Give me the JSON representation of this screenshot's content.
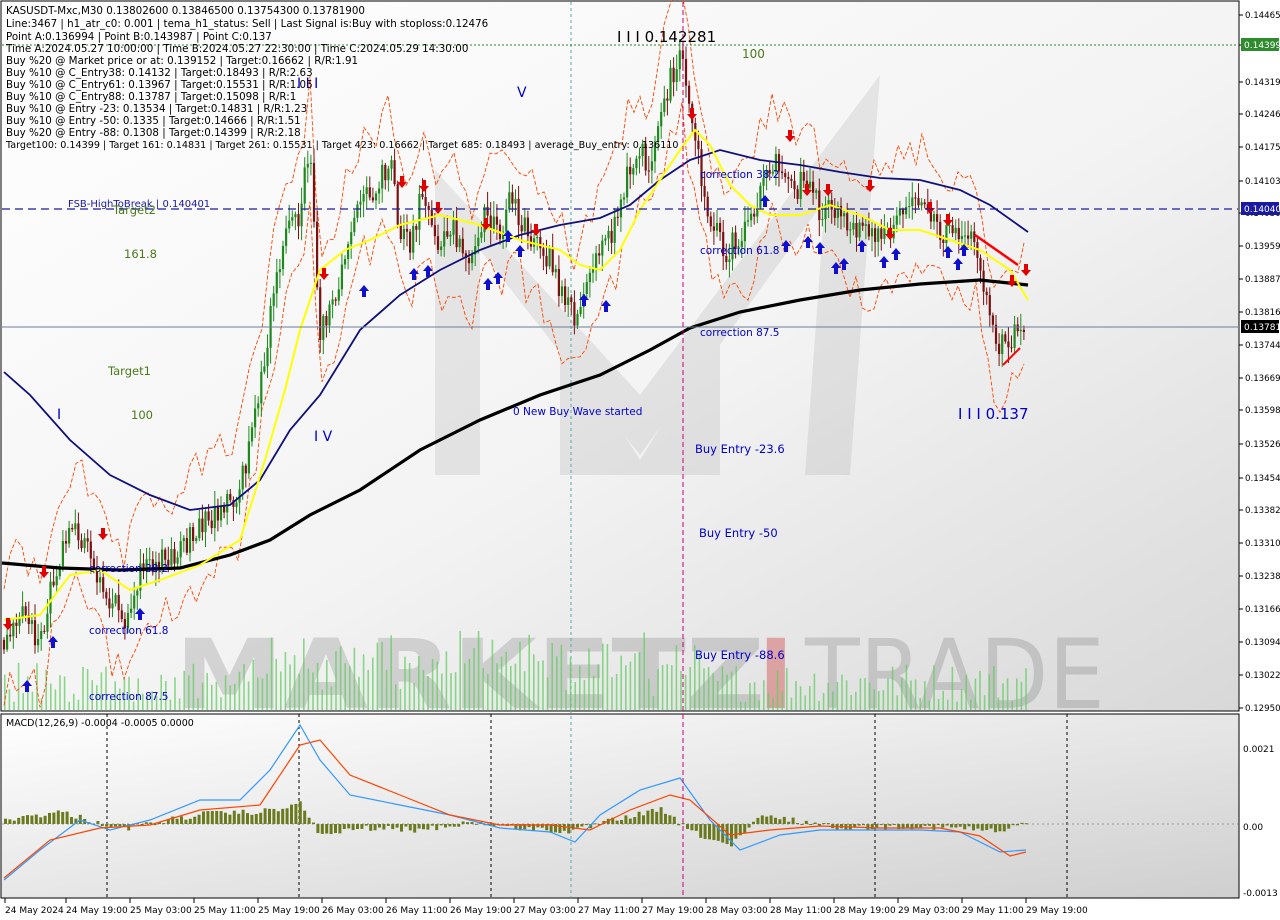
{
  "header": {
    "lines": [
      "KASUSDT-Mxc,M30  0.13802600 0.13846500 0.13754300 0.13781900",
      "Line:3467  |  h1_atr_c0: 0.001  |  tema_h1_status: Sell  |  Last Signal is:Buy with stoploss:0.12476",
      "Point A:0.136994  |  Point B:0.143987  |  Point C:0.137",
      "Time A:2024.05.27 10:00:00  |  Time B:2024.05.27 22:30:00  |  Time C:2024.05.29 14:30:00",
      "Buy %20 @ Market price or at: 0.139152  |  Target:0.16662  |  R/R:1.91",
      "Buy %10 @ C_Entry38: 0.14132  |  Target:0.18493  |  R/R:2.63",
      "Buy %10 @ C_Entry61: 0.13967  |  Target:0.15531  |  R/R:1.05",
      "Buy %10 @ C_Entry88: 0.13787  |  Target:0.15098  |  R/R:1",
      "Buy %10 @ Entry -23: 0.13534  |  Target:0.14831  |  R/R:1.23",
      "Buy %10 @ Entry -50: 0.1335  |  Target:0.14666  |  R/R:1.51",
      "Buy %20 @ Entry -88: 0.1308  |  Target:0.14399  |  R/R:2.18",
      "Target100: 0.14399  |  Target 161: 0.14831  |  Target 261: 0.15531  |  Target 423: 0.16662  |  Target 685: 0.18493  |  average_Buy_entry: 0.136110"
    ]
  },
  "annotations": {
    "wave_top": "I I I 0.142281",
    "level_100_top": "100",
    "wave_I_II": "I I I",
    "wave_V": "V",
    "fsb": "FSB-HighToBreak | 0.140401",
    "target2": "Target2",
    "fib_161": "161.8",
    "target1": "Target1",
    "level_100": "100",
    "wave_I": "I",
    "wave_IV": "I V",
    "new_buy_wave": "0 New Buy Wave started",
    "corr_382_right": "correction 38.2",
    "corr_618_right": "correction 61.8",
    "corr_875_right": "correction 87.5",
    "corr_382_left": "correction 38.2",
    "corr_618_left": "correction 61.8",
    "corr_875_left": "correction 87.5",
    "buy_entry_236": "Buy Entry -23.6",
    "buy_entry_50": "Buy Entry -50",
    "buy_entry_886": "Buy Entry -88.6",
    "wave_bottom": "I I I 0.137"
  },
  "watermark": {
    "left": "MARKETZ",
    "i": "I",
    "right": "TRADE"
  },
  "macd_label": "MACD(12,26,9) -0.0004 -0.0005 0.0000",
  "price_axis": {
    "ticks": [
      "0.14465",
      "0.14391",
      "0.14319",
      "0.14246",
      "0.14175",
      "0.14103",
      "0.14030",
      "0.13959",
      "0.13887",
      "0.13816",
      "0.13744",
      "0.13669",
      "0.13598",
      "0.13526",
      "0.13454",
      "0.13382",
      "0.13310",
      "0.13238",
      "0.13166",
      "0.13094",
      "0.13022",
      "0.12950"
    ],
    "target_badge": "0.14399",
    "fsb_badge": "0.14040",
    "current_badge": "0.13781"
  },
  "macd_axis": {
    "ticks": [
      "0.0021",
      "0.00",
      "-0.0013"
    ]
  },
  "time_axis": {
    "labels": [
      "24 May 2024",
      "24 May 19:00",
      "25 May 03:00",
      "25 May 11:00",
      "25 May 19:00",
      "26 May 03:00",
      "26 May 11:00",
      "26 May 19:00",
      "27 May 03:00",
      "27 May 11:00",
      "27 May 19:00",
      "28 May 03:00",
      "28 May 11:00",
      "28 May 19:00",
      "29 May 03:00",
      "29 May 11:00",
      "29 May 19:00"
    ]
  },
  "colors": {
    "bull": "#1e8a1e",
    "bear": "#7a1010",
    "ma_navy": "#10107a",
    "ma_black": "#000000",
    "ma_yellow": "#ffff00",
    "envelope": "#ff4500",
    "annotation": "#0000cc",
    "fsb": "#1a1aa0",
    "target": "#4a7a1a",
    "macd_line": "#3399ff",
    "signal_line": "#ff4500",
    "macd_hist": "#6b7a1e",
    "volume": "#66cc66",
    "arrow_up": "#1010cc",
    "arrow_down": "#e00000"
  },
  "icons": [
    "buy-arrow-icon",
    "sell-arrow-icon"
  ]
}
